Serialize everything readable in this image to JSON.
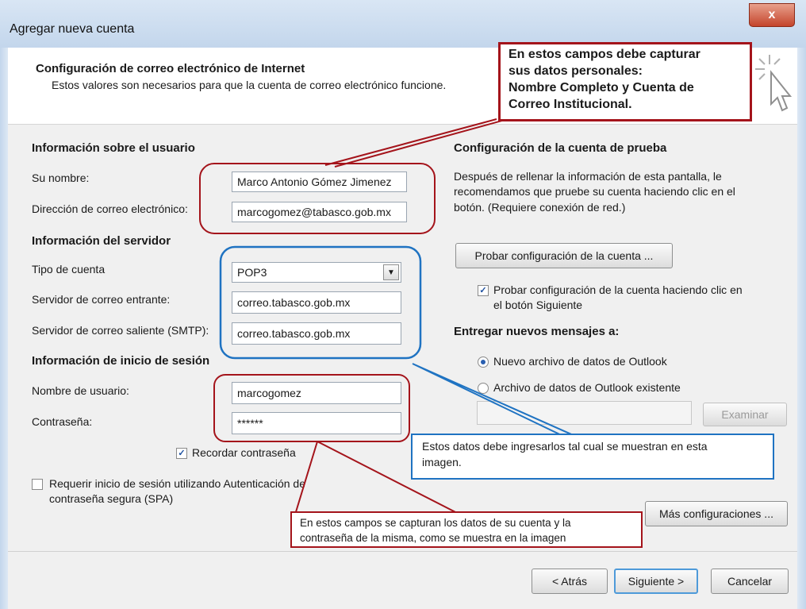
{
  "window": {
    "title": "Agregar nueva cuenta",
    "close": "x"
  },
  "header": {
    "title": "Configuración de correo electrónico de Internet",
    "subtitle": "Estos valores son necesarios para que la cuenta de correo electrónico funcione."
  },
  "user_info": {
    "section": "Información sobre el usuario",
    "name_label": "Su nombre:",
    "name_value": "Marco Antonio Gómez Jimenez",
    "email_label": "Dirección de correo electrónico:",
    "email_value": "marcogomez@tabasco.gob.mx"
  },
  "server_info": {
    "section": "Información del servidor",
    "type_label": "Tipo de cuenta",
    "type_value": "POP3",
    "incoming_label": "Servidor de correo entrante:",
    "incoming_value": "correo.tabasco.gob.mx",
    "outgoing_label": "Servidor de correo saliente (SMTP):",
    "outgoing_value": "correo.tabasco.gob.mx"
  },
  "logon_info": {
    "section": "Información de inicio de sesión",
    "user_label": "Nombre de usuario:",
    "user_value": "marcogomez",
    "pass_label": "Contraseña:",
    "pass_value": "******",
    "remember_label": "Recordar contraseña",
    "spa_label_1": "Requerir inicio de sesión utilizando Autenticación de",
    "spa_label_2": "contraseña segura (SPA)"
  },
  "test_config": {
    "section": "Configuración de la cuenta de prueba",
    "desc_1": "Después de rellenar la información de esta pantalla, le",
    "desc_2": "recomendamos que pruebe su cuenta haciendo clic en el",
    "desc_3": "botón. (Requiere conexión de red.)",
    "test_button": "Probar configuración de la cuenta ...",
    "test_check_1": "Probar configuración de la cuenta haciendo clic en",
    "test_check_2": "el botón Siguiente"
  },
  "deliver": {
    "section": "Entregar nuevos mensajes a:",
    "option_new": "Nuevo archivo de datos de Outlook",
    "option_existing": "Archivo de datos de Outlook existente",
    "browse": "Examinar"
  },
  "more_settings": "Más configuraciones ...",
  "footer": {
    "back": "< Atrás",
    "next": "Siguiente >",
    "cancel": "Cancelar"
  },
  "callouts": {
    "top_1": "En estos campos debe capturar",
    "top_2": "sus datos personales:",
    "top_3": "Nombre Completo y Cuenta de",
    "top_4": "Correo Institucional.",
    "blue_1": "Estos datos debe ingresarlos tal cual se muestran en esta",
    "blue_2": "imagen.",
    "bottom_1": "En estos campos se capturan los datos de su cuenta y la",
    "bottom_2": "contraseña de la misma, como se muestra en la imagen"
  },
  "colors": {
    "red_annotation": "#a4141b",
    "blue_annotation": "#1f73c2"
  }
}
